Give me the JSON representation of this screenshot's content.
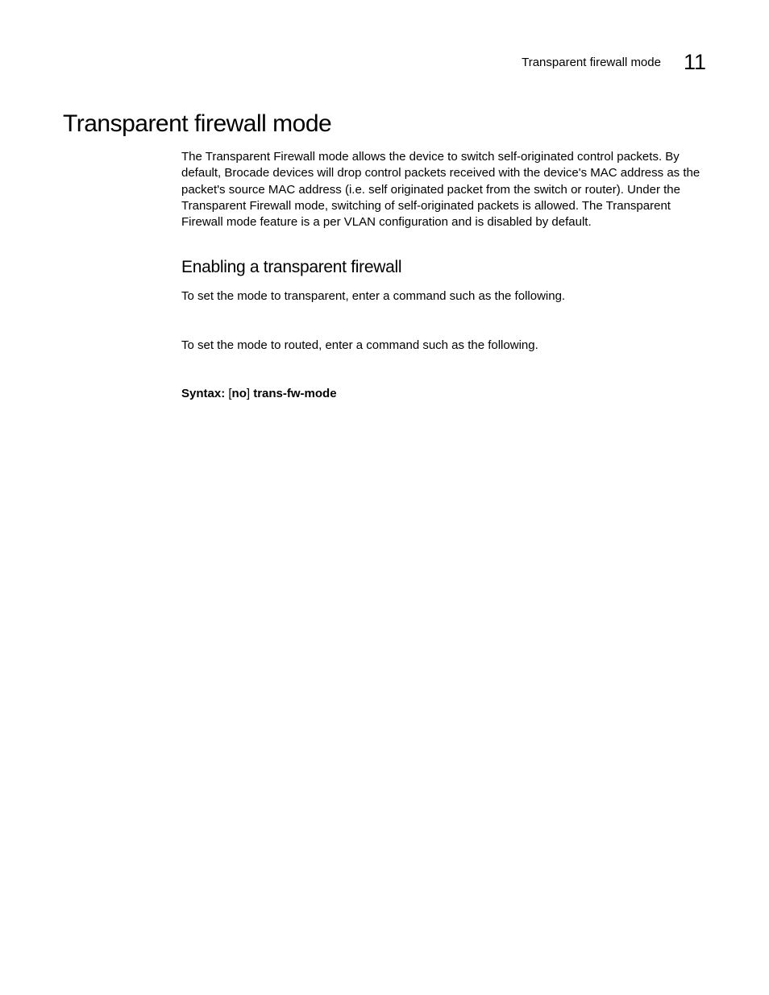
{
  "header": {
    "title": "Transparent firewall mode",
    "chapter": "11"
  },
  "main": {
    "heading": "Transparent firewall mode",
    "intro_paragraph": "The Transparent Firewall mode allows the device to switch self-originated control packets. By default, Brocade devices will drop control packets received with the device's MAC address as the packet's source MAC address (i.e. self originated packet from the switch or router). Under the Transparent Firewall mode, switching of self-originated packets is allowed. The Transparent Firewall mode feature is a per VLAN configuration and is disabled by default.",
    "sub_heading": "Enabling a transparent firewall",
    "instruction_1": "To set the mode to transparent, enter a command such as the following.",
    "instruction_2": "To set the mode to routed, enter a command such as the following.",
    "syntax": {
      "label": "Syntax:",
      "bracket_open": "[",
      "no": "no",
      "bracket_close": "]",
      "command": "trans-fw-mode"
    }
  }
}
